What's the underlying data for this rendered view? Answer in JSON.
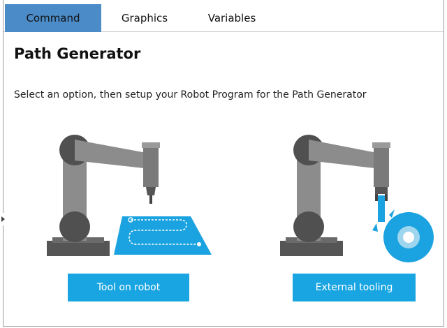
{
  "tabs": [
    {
      "label": "Command",
      "active": true
    },
    {
      "label": "Graphics",
      "active": false
    },
    {
      "label": "Variables",
      "active": false
    }
  ],
  "page": {
    "title": "Path Generator",
    "subtitle": "Select an option, then setup your Robot Program for the Path Generator"
  },
  "options": {
    "tool_on_robot": "Tool on robot",
    "external_tooling": "External tooling"
  },
  "colors": {
    "tab_active": "#4a8bc8",
    "button": "#19a5e2",
    "robot_gray": "#8a8a8a",
    "robot_dark": "#555555",
    "accent_blue": "#1aa3e0"
  },
  "icons": {
    "collapse_handle": "chevron-right-icon"
  }
}
